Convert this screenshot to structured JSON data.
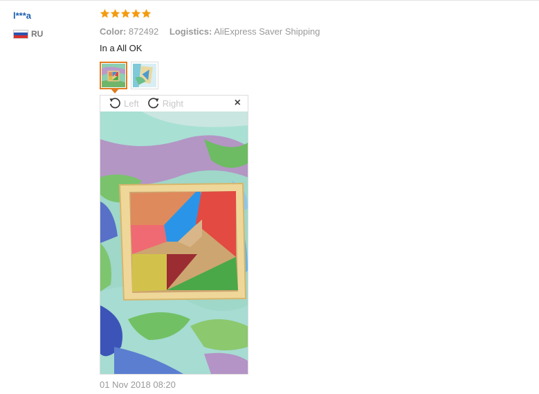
{
  "review": {
    "user_name": "l***a",
    "country_code": "RU",
    "rating": 5,
    "color_label": "Color:",
    "color_value": "872492",
    "logistics_label": "Logistics:",
    "logistics_value": "AliExpress Saver Shipping",
    "text": "In a All OK",
    "date": "01 Nov 2018 08:20",
    "colors": {
      "star": "#f39c12",
      "user": "#1b5fb3",
      "active_thumb": "#e07b20"
    }
  },
  "viewer": {
    "rotate_left_label": "Left",
    "rotate_right_label": "Right",
    "close_icon": "×"
  },
  "thumbnails": [
    {
      "name": "photo-1",
      "active": true
    },
    {
      "name": "photo-2",
      "active": false
    }
  ]
}
